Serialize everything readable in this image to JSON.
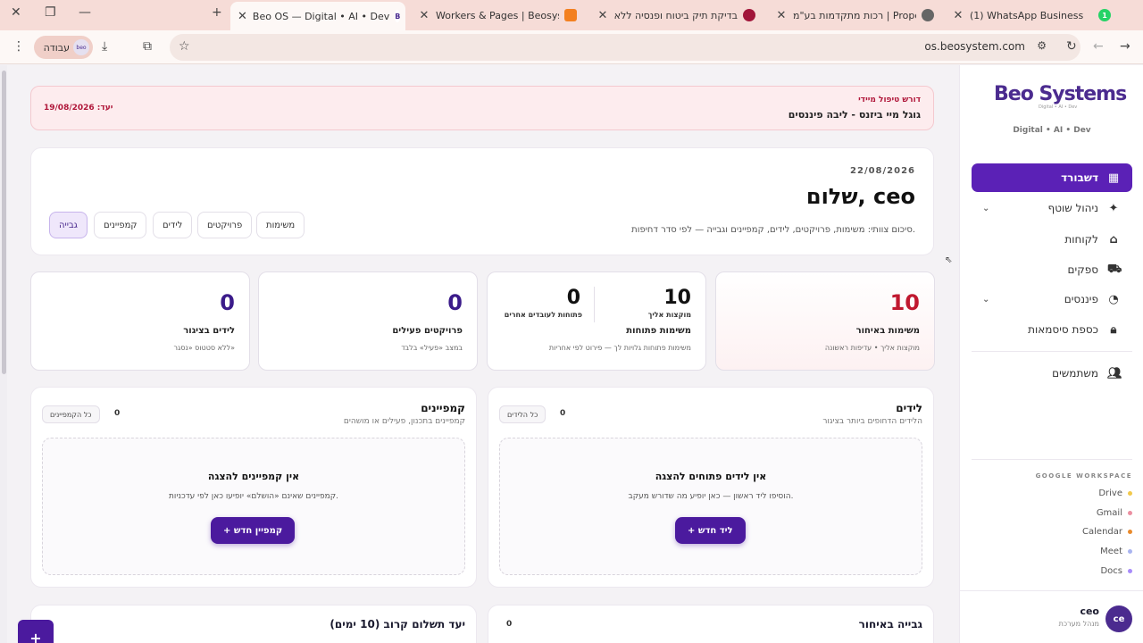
{
  "browser": {
    "tabs": [
      {
        "title": "(1) WhatsApp Business",
        "badge": "1"
      },
      {
        "title": "רכות מתקדמות בע\"מ | Proposal"
      },
      {
        "title": "בדיקת תיק ביטוח ופנסיה ללא ע"
      },
      {
        "title": "Workers & Pages | Beosystems"
      },
      {
        "title": "Beo OS — Digital • AI • Dev",
        "fav": "B"
      }
    ],
    "url": "os.beosystem.com",
    "profile_label": "עבודה",
    "profile_avatar_text": "beo"
  },
  "sidebar": {
    "brand": "Beo Systems",
    "brand_sub": "Digital • AI • Dev",
    "tagline": "Digital • AI • Dev",
    "items": [
      {
        "label": "דשבורד",
        "icon": "grid-icon"
      },
      {
        "label": "ניהול שוטף",
        "icon": "sparkle-icon"
      },
      {
        "label": "לקוחות",
        "icon": "building-icon"
      },
      {
        "label": "ספקים",
        "icon": "truck-icon"
      },
      {
        "label": "פיננסים",
        "icon": "pie-icon"
      },
      {
        "label": "כספת סיסמאות",
        "icon": "lock-icon"
      },
      {
        "label": "משתמשים",
        "icon": "users-icon"
      }
    ],
    "google_workspace_title": "GOOGLE WORKSPACE",
    "google_links": [
      {
        "label": "Drive",
        "color": "#f2c94c"
      },
      {
        "label": "Gmail",
        "color": "#eb8fa1"
      },
      {
        "label": "Calendar",
        "color": "#e98a2c"
      },
      {
        "label": "Meet",
        "color": "#a9b4f0"
      },
      {
        "label": "Docs",
        "color": "#a78bfa"
      }
    ],
    "user": {
      "initials": "ce",
      "name": "ceo",
      "role": "מנהל מערכת"
    }
  },
  "alert": {
    "label": "דורש טיפול מיידי",
    "title": "גוגל מיי ביזנס - ליבה פיננסים",
    "due": "יעד: 19/08/2026"
  },
  "hero": {
    "date": "22/08/2026",
    "greeting": "שלום, ceo",
    "summary": "סיכום צוותי: משימות, פרויקטים, לידים, קמפיינים וגבייה — לפי סדר דחיפות.",
    "chips": [
      "משימות",
      "פרויקטים",
      "לידים",
      "קמפיינים",
      "גבייה"
    ]
  },
  "stats": {
    "overdue": {
      "value": "10",
      "title": "משימות באיחור",
      "sub": "מוקצות אליך • עדיפות ראשונה"
    },
    "open": {
      "assigned_value": "10",
      "assigned_label": "מוקצות אליך",
      "others_value": "0",
      "others_label": "פתוחות לעובדים אחרים",
      "title": "משימות פתוחות",
      "sub": "משימות פתוחות גלויות לך — פירוט לפי אחריות"
    },
    "projects": {
      "value": "0",
      "title": "פרויקטים פעילים",
      "sub": "במצב «פעיל» בלבד"
    },
    "leads": {
      "value": "0",
      "title": "לידים בציגור",
      "sub": "ללא סטטוס «נסגר»"
    }
  },
  "leads_panel": {
    "title": "לידים",
    "sub": "הלידים הדחופים ביותר בציגור",
    "count": "0",
    "all_label": "כל הלידים",
    "empty_title": "אין לידים פתוחים להצגה",
    "empty_desc": "הוסיפו ליד ראשון — כאן יופיע מה שדורש מעקב.",
    "button": "+ ליד חדש"
  },
  "campaigns_panel": {
    "title": "קמפיינים",
    "sub": "קמפיינים בתכנון, פעילים או מושהים",
    "count": "0",
    "all_label": "כל הקמפיינים",
    "empty_title": "אין קמפיינים להצגה",
    "empty_desc": "קמפיינים שאינם «הושלם» יופיעו כאן לפי עדכניות.",
    "button": "+ קמפיין חדש"
  },
  "bottom": {
    "collections_title": "גבייה באיחור",
    "collections_count": "0",
    "payments_title": "יעד תשלום קרוב (10 ימים)"
  },
  "fab": "+"
}
